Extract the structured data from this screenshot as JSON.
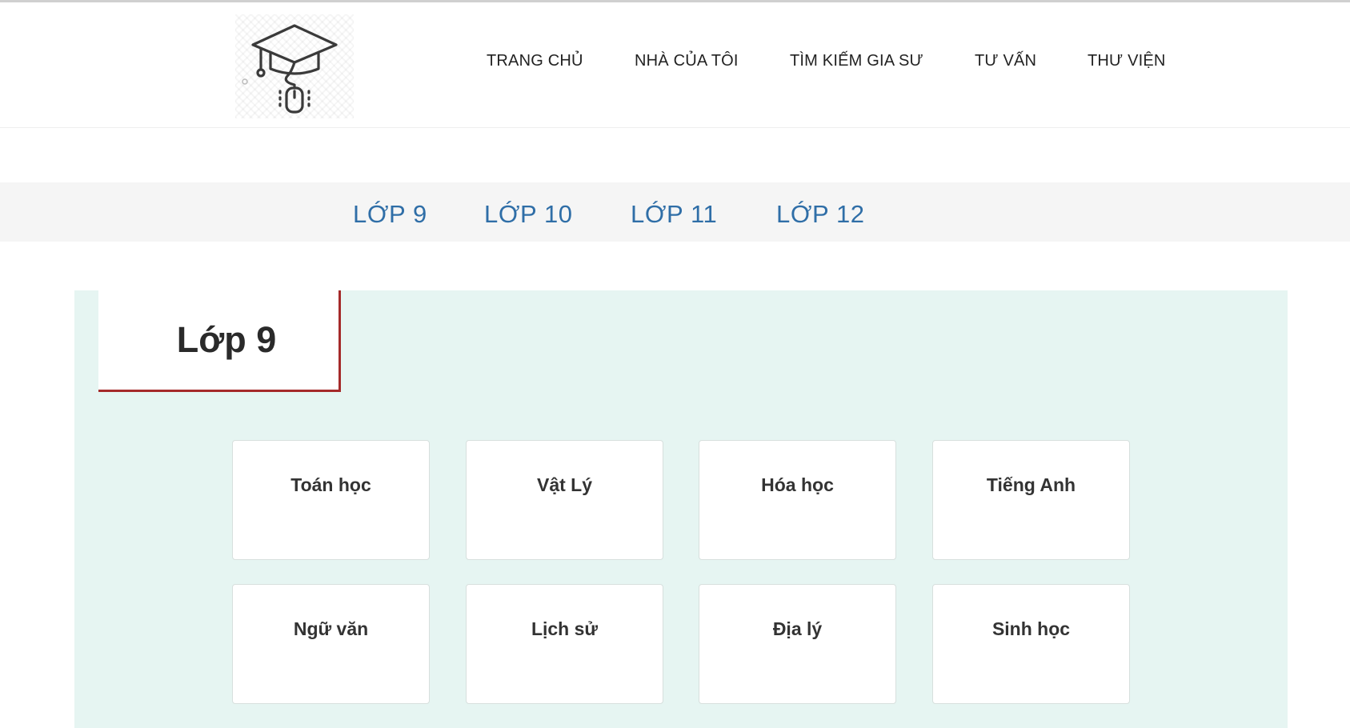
{
  "nav": {
    "items": [
      {
        "label": "TRANG CHỦ"
      },
      {
        "label": "NHÀ CỦA TÔI"
      },
      {
        "label": "TÌM KIẾM GIA SƯ"
      },
      {
        "label": "TƯ VẤN"
      },
      {
        "label": "THƯ VIỆN"
      }
    ]
  },
  "logo": {
    "icon": "graduation-cap-mouse-icon"
  },
  "grades": {
    "tabs": [
      {
        "label": "LỚP 9"
      },
      {
        "label": "LỚP 10"
      },
      {
        "label": "LỚP 11"
      },
      {
        "label": "LỚP 12"
      }
    ]
  },
  "section": {
    "title": "Lớp 9",
    "accent_color": "#a52a2a",
    "subjects": [
      {
        "label": "Toán học"
      },
      {
        "label": "Vật Lý"
      },
      {
        "label": "Hóa học"
      },
      {
        "label": "Tiếng Anh"
      },
      {
        "label": "Ngữ văn"
      },
      {
        "label": "Lịch sử"
      },
      {
        "label": "Địa lý"
      },
      {
        "label": "Sinh học"
      }
    ]
  },
  "colors": {
    "link_blue": "#2f6ea7",
    "panel_bg": "#e6f5f2",
    "strip_bg": "#f5f5f5"
  }
}
